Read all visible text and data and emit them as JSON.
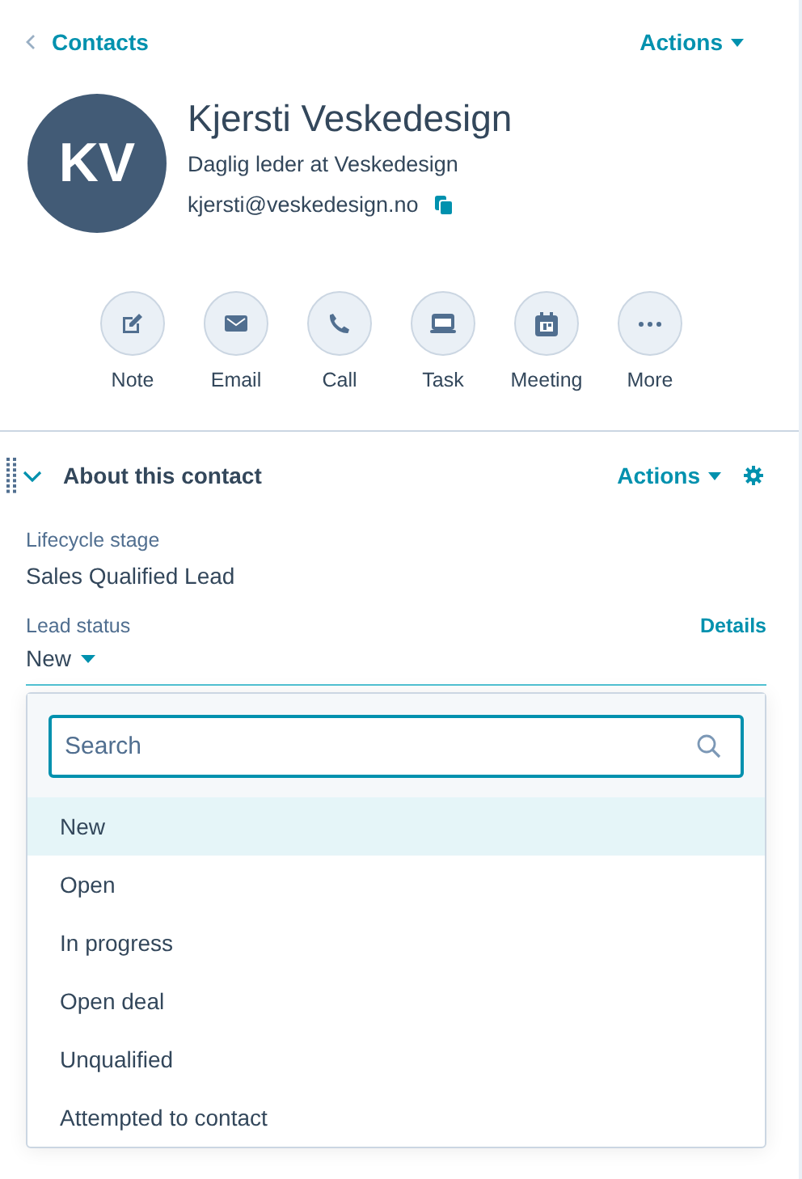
{
  "header": {
    "back_link": "Contacts",
    "actions": "Actions"
  },
  "contact": {
    "initials": "KV",
    "name": "Kjersti Veskedesign",
    "title": "Daglig leder at Veskedesign",
    "email": "kjersti@veskedesign.no"
  },
  "quick_actions": [
    {
      "label": "Note",
      "kind": "note"
    },
    {
      "label": "Email",
      "kind": "email"
    },
    {
      "label": "Call",
      "kind": "call"
    },
    {
      "label": "Task",
      "kind": "task"
    },
    {
      "label": "Meeting",
      "kind": "meeting"
    },
    {
      "label": "More",
      "kind": "more"
    }
  ],
  "section": {
    "title": "About this contact",
    "expanded": true,
    "actions": "Actions"
  },
  "properties": [
    {
      "label": "Lifecycle stage",
      "value": "Sales Qualified Lead"
    }
  ],
  "lead_status": {
    "label": "Lead status",
    "link": "Details",
    "value": "New"
  },
  "dropdown": {
    "search": {
      "placeholder": "Search"
    },
    "options": [
      {
        "label": "New",
        "selected": true
      },
      {
        "label": "Open",
        "selected": false
      },
      {
        "label": "In progress",
        "selected": false
      },
      {
        "label": "Open deal",
        "selected": false
      },
      {
        "label": "Unqualified",
        "selected": false
      },
      {
        "label": "Attempted to contact",
        "selected": false
      }
    ]
  }
}
